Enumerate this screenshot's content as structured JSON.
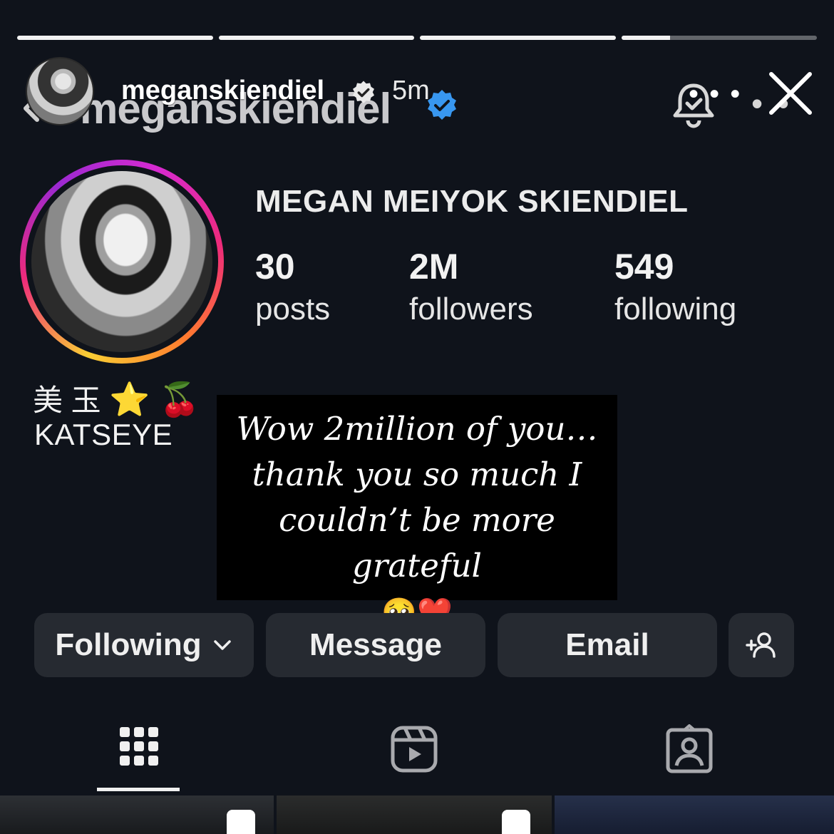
{
  "story": {
    "progress": [
      1,
      1,
      1,
      0.25
    ],
    "username": "meganskiendiel",
    "time_ago": "5m",
    "more_label": "• • •",
    "close_icon": "close-icon"
  },
  "profile": {
    "username": "meganskiendiel",
    "display_name": "MEGAN MEIYOK SKIENDIEL",
    "stats": {
      "posts": {
        "count": "30",
        "label": "posts"
      },
      "followers": {
        "count": "2M",
        "label": "followers"
      },
      "following": {
        "count": "549",
        "label": "following"
      }
    },
    "bio_line1_text": "美 玉",
    "bio_line1_emojis": "⭐ 🍒",
    "bio_line2": "KATSEYE",
    "more_label": "• •"
  },
  "text_card": {
    "quote": "Wow 2million of you… thank you so much I couldn’t be more grateful",
    "emojis": "🥹❤️"
  },
  "buttons": {
    "following": "Following",
    "message": "Message",
    "email": "Email"
  },
  "tabs": [
    "grid-tab",
    "reels-tab",
    "tagged-tab"
  ],
  "colors": {
    "verified_blue": "#3897f0",
    "background": "#0f131b",
    "button": "#262a31"
  }
}
